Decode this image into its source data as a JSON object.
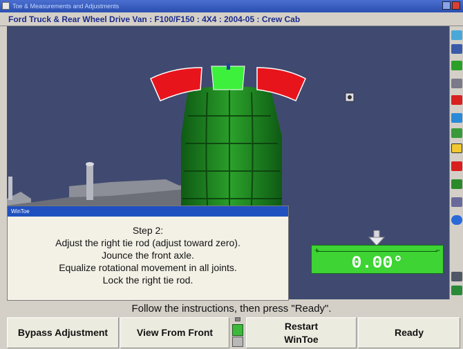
{
  "window": {
    "title": "Toe & Measurements and Adjustments",
    "subtitle": "Ford Truck & Rear Wheel Drive Van : F100/F150 : 4X4 : 2004-05 : Crew Cab"
  },
  "dialog": {
    "title": "WinToe",
    "lines": [
      "Step 2:",
      "Adjust the right tie rod (adjust toward zero).",
      "Jounce the front axle.",
      "Equalize rotational movement in all joints.",
      "Lock the right tie rod."
    ]
  },
  "gauge": {
    "value": "0.00°",
    "plus": "+",
    "minus": "−",
    "color": "#3dd434"
  },
  "instruction": "Follow the instructions, then press \"Ready\".",
  "buttons": {
    "bypass": "Bypass Adjustment",
    "view_front": "View From Front",
    "restart_line1": "Restart",
    "restart_line2": "WinToe",
    "ready": "Ready"
  },
  "colors": {
    "viewport_bg": "#404a70",
    "tire": "#1f8a1f",
    "target_arc": "#e8141c",
    "target_center": "#3cf03c"
  },
  "icons": {
    "sidebar": [
      "help-icon",
      "alignment-icon",
      "measure-icon",
      "tools-icon",
      "car-icon",
      "gauge-icon",
      "settings-icon",
      "wintoe-icon",
      "spec-icon",
      "adjust-icon",
      "print-icon",
      "globe-icon",
      "camera-icon",
      "exit-icon"
    ]
  }
}
